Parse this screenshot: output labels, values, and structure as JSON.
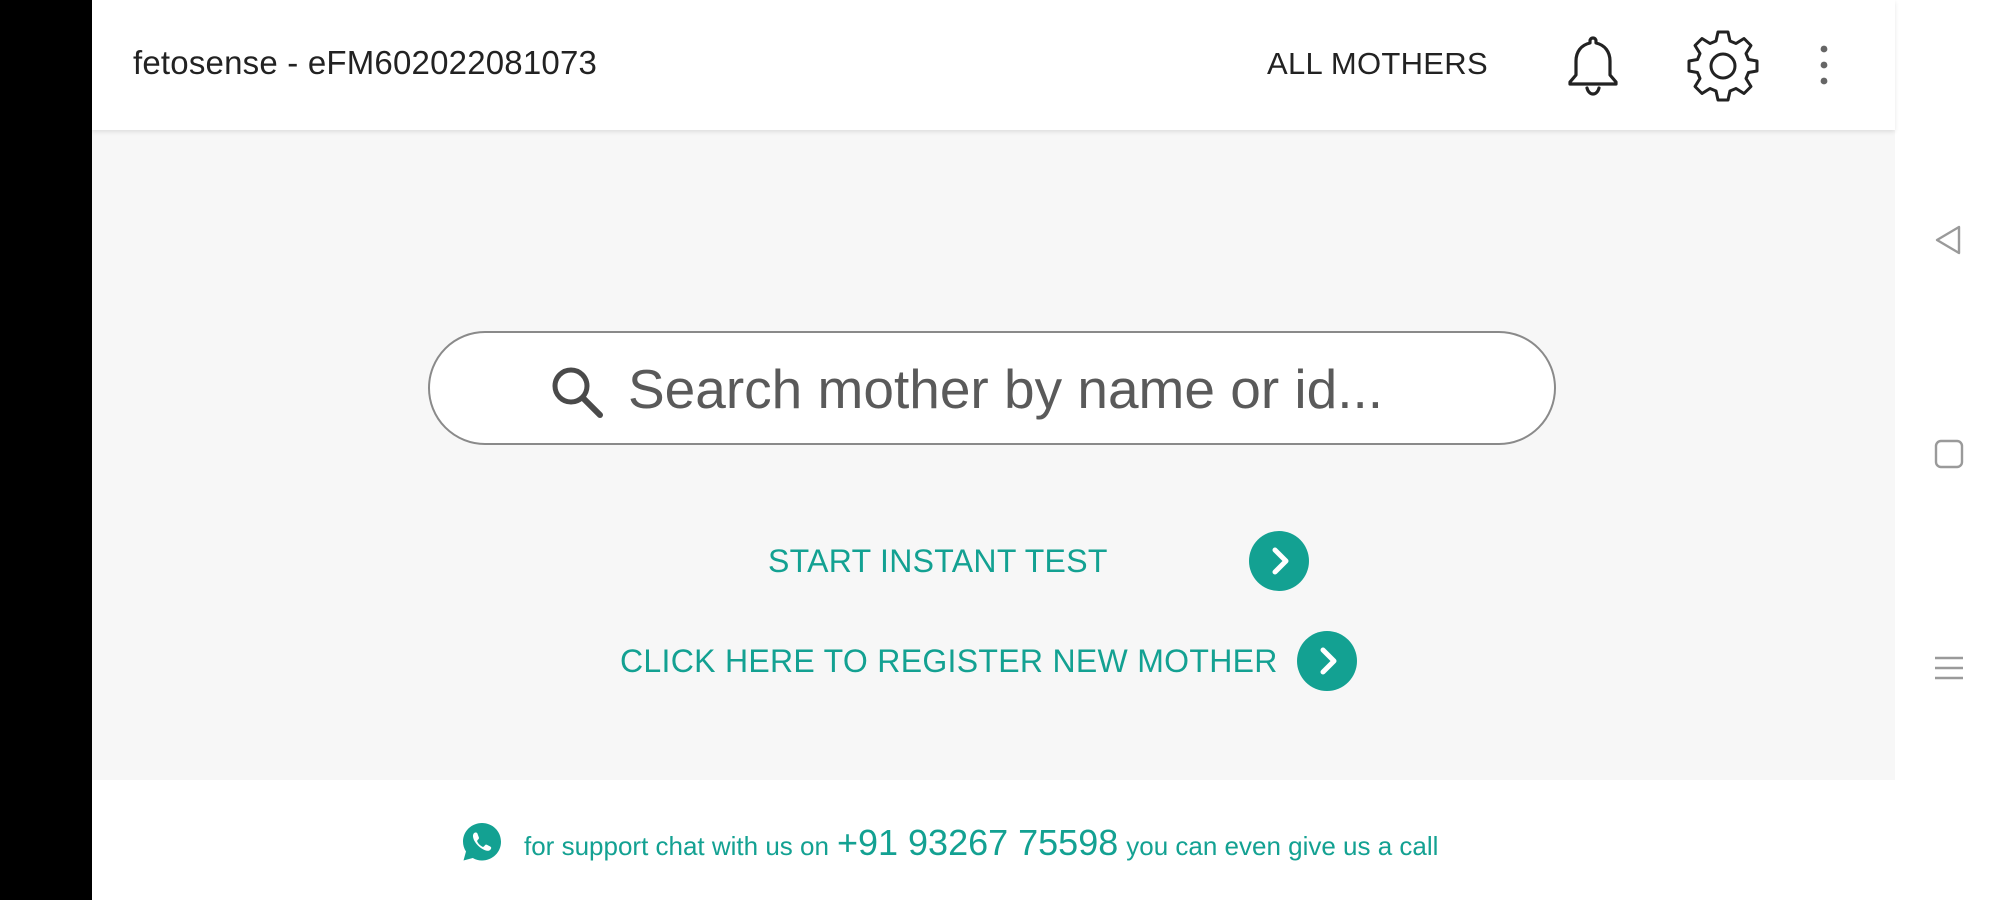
{
  "app_bar": {
    "title": "fetosense - eFM602022081073",
    "all_mothers_label": "ALL MOTHERS",
    "icons": [
      "bell-icon",
      "gear-icon",
      "more-vert-icon"
    ]
  },
  "search": {
    "placeholder": "Search mother by name or id...",
    "value": "",
    "icon": "search-icon"
  },
  "actions": {
    "start_instant_test": "START INSTANT TEST",
    "register_new_mother": "CLICK HERE TO REGISTER NEW MOTHER",
    "arrow_icon": "chevron-right-icon"
  },
  "support": {
    "icon": "whatsapp-icon",
    "text_before": "for support chat with us on",
    "phone": "+91 93267 75598",
    "text_after": "you can even give us a call"
  },
  "system_nav": {
    "icons": [
      "back-icon",
      "home-icon",
      "recents-icon"
    ]
  },
  "colors": {
    "accent": "#13a192",
    "background": "#f7f7f7",
    "app_bar": "#ffffff",
    "text_primary": "#222222"
  }
}
